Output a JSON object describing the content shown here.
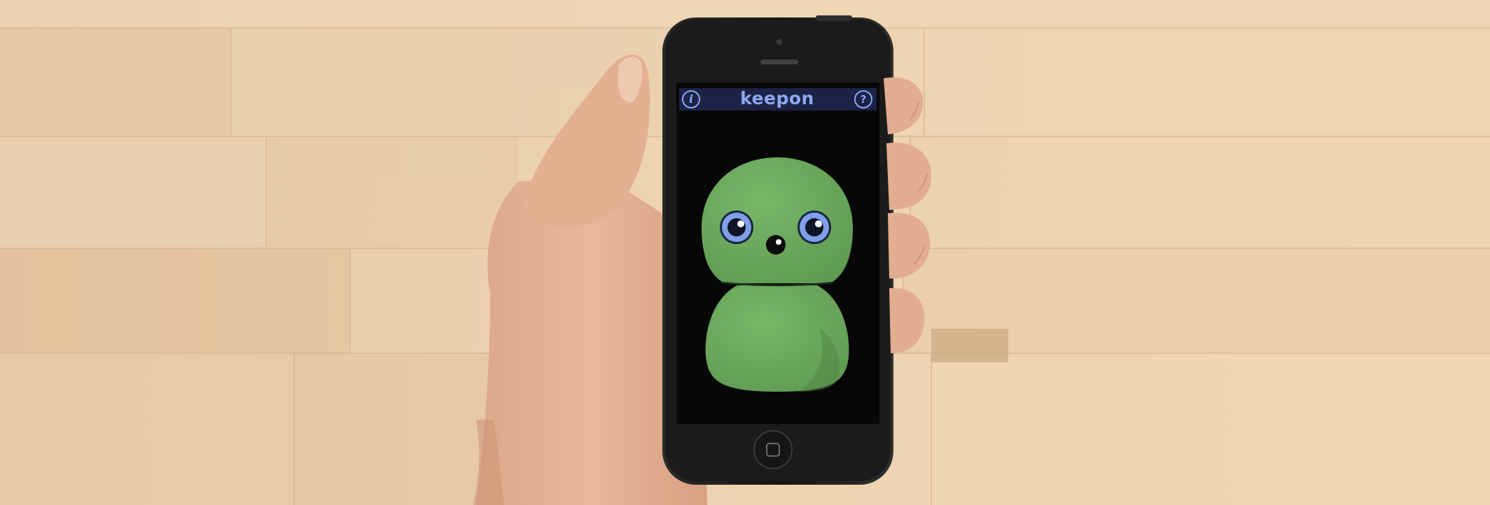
{
  "app": {
    "title": "keepon",
    "info_button_label": "i",
    "help_button_label": "?"
  },
  "colors": {
    "table_wood": "#e8c9a0",
    "phone_body": "#1c1c1c",
    "header_bar": "#1c2346",
    "header_accent": "#8ea8f0",
    "keepon_green": "#6aa95c",
    "eye_blue": "#7fa0e8",
    "hand_skin": "#e7b597"
  },
  "icons": {
    "info": "info-icon",
    "help": "question-mark-icon",
    "home": "home-button-icon"
  }
}
